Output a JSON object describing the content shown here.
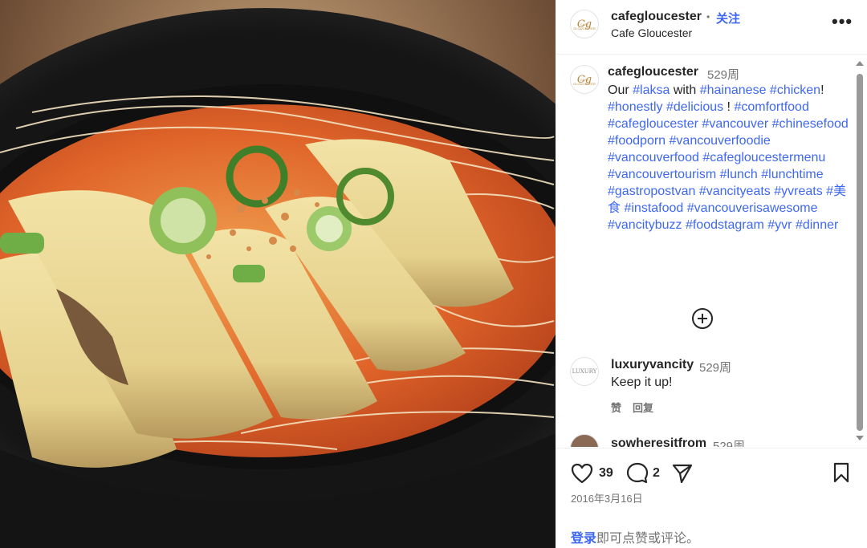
{
  "header": {
    "username": "cafegloucester",
    "dot": "•",
    "follow_label": "关注",
    "location": "Cafe Gloucester",
    "more_label": "•••"
  },
  "avatar": {
    "brand_text": "Cg",
    "brand_sub": "CAFE GLOUCESTER"
  },
  "caption": {
    "username": "cafegloucester",
    "time": "529周",
    "segments": [
      {
        "t": "Our ",
        "tag": false
      },
      {
        "t": "#laksa",
        "tag": true
      },
      {
        "t": " with ",
        "tag": false
      },
      {
        "t": "#hainanese",
        "tag": true
      },
      {
        "t": " ",
        "tag": false
      },
      {
        "t": "#chicken",
        "tag": true
      },
      {
        "t": "! ",
        "tag": false
      },
      {
        "t": "#honestly",
        "tag": true
      },
      {
        "t": " ",
        "tag": false
      },
      {
        "t": "#delicious",
        "tag": true
      },
      {
        "t": " ! ",
        "tag": false
      },
      {
        "t": "#comfortfood",
        "tag": true
      },
      {
        "t": " ",
        "tag": false
      },
      {
        "t": "#cafegloucester",
        "tag": true
      },
      {
        "t": " ",
        "tag": false
      },
      {
        "t": "#vancouver",
        "tag": true
      },
      {
        "t": " ",
        "tag": false
      },
      {
        "t": "#chinesefood",
        "tag": true
      },
      {
        "t": " ",
        "tag": false
      },
      {
        "t": "#foodporn",
        "tag": true
      },
      {
        "t": " ",
        "tag": false
      },
      {
        "t": "#vancouverfoodie",
        "tag": true
      },
      {
        "t": " ",
        "tag": false
      },
      {
        "t": "#vancouverfood",
        "tag": true
      },
      {
        "t": " ",
        "tag": false
      },
      {
        "t": "#cafegloucestermenu",
        "tag": true
      },
      {
        "t": " ",
        "tag": false
      },
      {
        "t": "#vancouvertourism",
        "tag": true
      },
      {
        "t": " ",
        "tag": false
      },
      {
        "t": "#lunch",
        "tag": true
      },
      {
        "t": " ",
        "tag": false
      },
      {
        "t": "#lunchtime",
        "tag": true
      },
      {
        "t": "  ",
        "tag": false
      },
      {
        "t": "#gastropostvan",
        "tag": true
      },
      {
        "t": " ",
        "tag": false
      },
      {
        "t": "#vancityeats",
        "tag": true
      },
      {
        "t": " ",
        "tag": false
      },
      {
        "t": "#yvreats",
        "tag": true
      },
      {
        "t": " ",
        "tag": false
      },
      {
        "t": "#美食",
        "tag": true
      },
      {
        "t": " ",
        "tag": false
      },
      {
        "t": "#instafood",
        "tag": true
      },
      {
        "t": " ",
        "tag": false
      },
      {
        "t": "#vancouverisawesome",
        "tag": true
      },
      {
        "t": " ",
        "tag": false
      },
      {
        "t": "#vancitybuzz",
        "tag": true
      },
      {
        "t": " ",
        "tag": false
      },
      {
        "t": "#foodstagram",
        "tag": true
      },
      {
        "t": " ",
        "tag": false
      },
      {
        "t": "#yvr",
        "tag": true
      },
      {
        "t": " ",
        "tag": false
      },
      {
        "t": "#dinner",
        "tag": true
      }
    ]
  },
  "comments": [
    {
      "username": "luxuryvancity",
      "time": "529周",
      "text": "Keep it up!",
      "like_label": "赞",
      "reply_label": "回复",
      "avatar_text": "LUXURY"
    },
    {
      "username": "sowheresitfrom",
      "time": "529周"
    }
  ],
  "actions": {
    "likes": "39",
    "comments": "2",
    "date": "2016年3月16日",
    "login_link": "登录",
    "login_rest": "即可点赞或评论。"
  },
  "colors": {
    "link_blue": "#3f68f0",
    "follow_blue": "#0095f6",
    "muted": "#737373",
    "text": "#262626"
  },
  "icons": [
    "heart-icon",
    "comment-icon",
    "share-icon",
    "bookmark-icon",
    "more-icon",
    "add-circle-icon"
  ]
}
